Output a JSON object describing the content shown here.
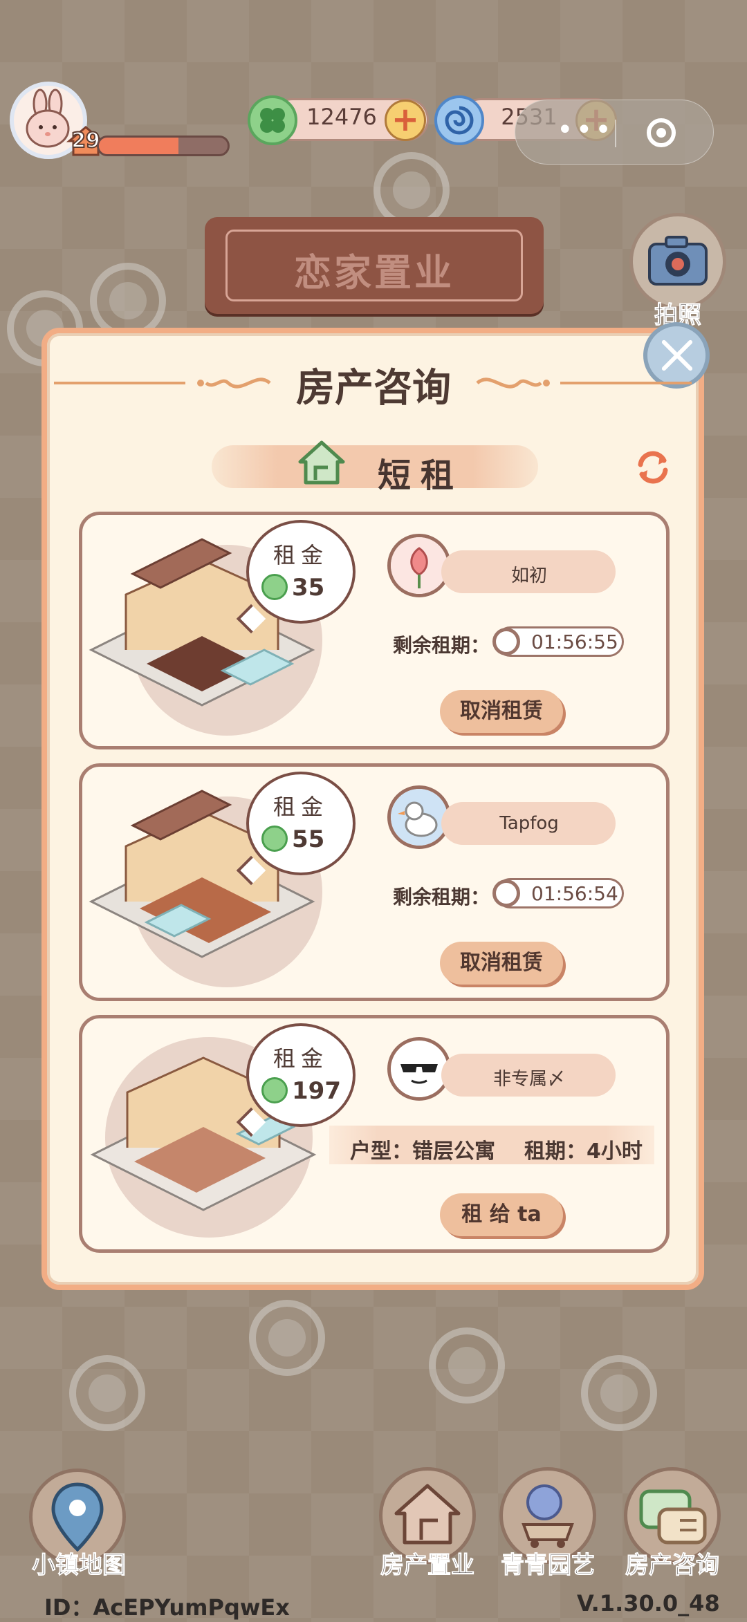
{
  "header": {
    "level": "29",
    "xp_progress": 0.62,
    "clover_count": "12476",
    "swirl_count": "2531"
  },
  "title_plaque": "恋家置业",
  "camera_label": "拍照",
  "panel": {
    "title": "房产咨询",
    "tab_label": "短租"
  },
  "cards": [
    {
      "rent_label": "租金",
      "rent_value": "35",
      "tenant_name": "如初",
      "remain_label": "剩余租期：",
      "timer": "01:56:55",
      "action_label": "取消租赁"
    },
    {
      "rent_label": "租金",
      "rent_value": "55",
      "tenant_name": "Tapfog",
      "remain_label": "剩余租期：",
      "timer": "01:56:54",
      "action_label": "取消租赁"
    },
    {
      "rent_label": "租金",
      "rent_value": "197",
      "tenant_name": "非专属〆",
      "house_type": "户型：错层公寓",
      "lease_term": "租期：4小时",
      "action_label": "租 给 ta"
    }
  ],
  "nav": {
    "map_label": "小镇地图",
    "property_label": "房产置业",
    "garden_label": "青青园艺",
    "consult_label": "房产咨询"
  },
  "footer": {
    "user_id": "ID：AcEPYumPqwEx",
    "version": "V.1.30.0_48"
  },
  "colors": {
    "panel_bg": "#fdf3e2",
    "panel_border": "#f2ad85",
    "button_bg": "#eebf9d",
    "coin_green": "#8ed18a"
  }
}
